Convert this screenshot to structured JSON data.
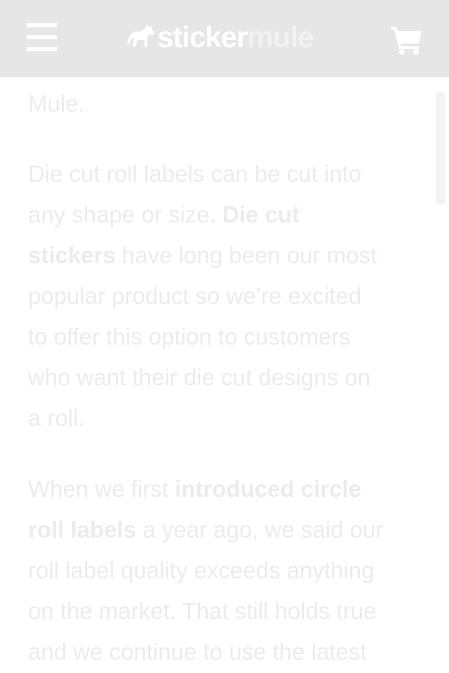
{
  "header": {
    "menu_icon": "hamburger-menu-icon",
    "logo_part1": "sticker",
    "logo_part2": "mule",
    "logo_icon": "mule-logo-icon",
    "cart_icon": "shopping-cart-icon"
  },
  "article": {
    "p0_text": "Mule.",
    "p1_lines": [
      "Die cut roll labels can be cut into",
      "any shape or size. ",
      "Die cut",
      "stickers",
      " have long been our most",
      "popular product so we’re excited",
      "to offer this option to customers",
      "who want their die cut designs on",
      "a roll."
    ],
    "p2_lines": [
      "When we first ",
      "introduced circle",
      "roll labels",
      " a year ago, we said our",
      "roll label quality exceeds anything",
      "on the market. That still holds true",
      "and we continue to use the latest"
    ]
  },
  "colors": {
    "header_bg": "#e6e6e6",
    "text": "#ececec"
  }
}
